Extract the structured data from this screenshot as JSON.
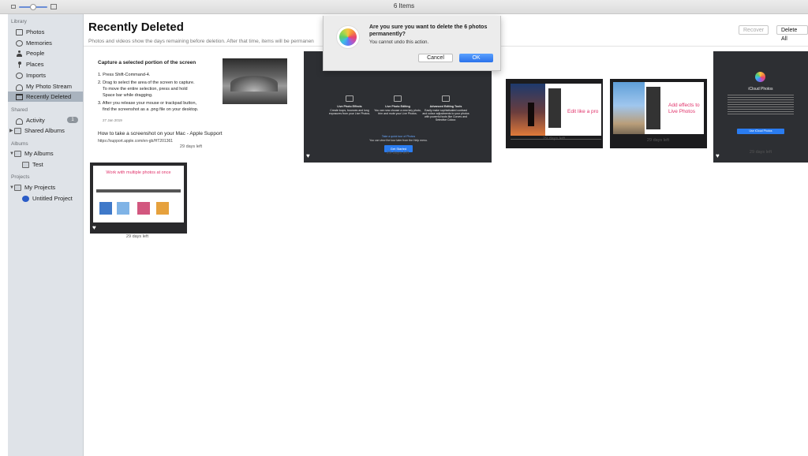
{
  "window": {
    "title": "6 Items"
  },
  "sidebar": {
    "library_header": "Library",
    "library": [
      {
        "label": "Photos",
        "icon": "photos-icon"
      },
      {
        "label": "Memories",
        "icon": "memories-icon"
      },
      {
        "label": "People",
        "icon": "people-icon"
      },
      {
        "label": "Places",
        "icon": "places-icon"
      },
      {
        "label": "Imports",
        "icon": "imports-icon"
      },
      {
        "label": "My Photo Stream",
        "icon": "photo-stream-icon"
      },
      {
        "label": "Recently Deleted",
        "icon": "trash-icon",
        "selected": true
      }
    ],
    "shared_header": "Shared",
    "shared": [
      {
        "label": "Activity",
        "badge": "1"
      },
      {
        "label": "Shared Albums"
      }
    ],
    "albums_header": "Albums",
    "albums": [
      {
        "label": "My Albums"
      },
      {
        "label": "Test"
      }
    ],
    "projects_header": "Projects",
    "projects": [
      {
        "label": "My Projects"
      },
      {
        "label": "Untitled Project"
      }
    ]
  },
  "main": {
    "title": "Recently Deleted",
    "subtitle": "Photos and videos show the days remaining before deletion. After that time, items will be permanen",
    "recover_label": "Recover",
    "delete_all_label": "Delete All",
    "days_left": "29 days left"
  },
  "thumbs": {
    "t1": {
      "heading": "Capture a selected portion of the screen",
      "lines": [
        "1. Press Shift-Command-4.",
        "2. Drag to select the area of the screen to capture.",
        "To move the entire selection, press and hold",
        "Space bar while dragging.",
        "3. After you release your mouse or trackpad button,",
        "find the screenshot as a .png file on your desktop."
      ],
      "date": "27 Jan 2019",
      "link": "How to take a screenshot on your Mac - Apple Support",
      "url": "https://support.apple.com/en-gb/HT201361"
    },
    "t2": {
      "cols": [
        {
          "title": "Live Photo Effects",
          "text": "Create loops, bounces and long exposures from your Live Photos."
        },
        {
          "title": "Live Photo Editing",
          "text": "You can now choose a new key photo, trim and mute your Live Photos."
        },
        {
          "title": "Advanced Editing Tools",
          "text": "Easily make sophisticated contrast and colour adjustments to your photos with powerful tools like Curves and Selective Colour."
        }
      ],
      "tour": "Take a quick tour of Photos",
      "tour_sub": "You can view the tour later from the Help menu.",
      "button": "Get Started"
    },
    "t3": {
      "heading": "Edit like a pro"
    },
    "t4": {
      "heading": "Add effects to Live Photos"
    },
    "t5": {
      "name": "iCloud Photos",
      "button": "Use iCloud Photos"
    },
    "t6": {
      "heading": "Work with multiple photos at once"
    }
  },
  "dialog": {
    "message": "Are you sure you want to delete the 6 photos permanently?",
    "sub": "You cannot undo this action.",
    "cancel": "Cancel",
    "ok": "OK"
  }
}
